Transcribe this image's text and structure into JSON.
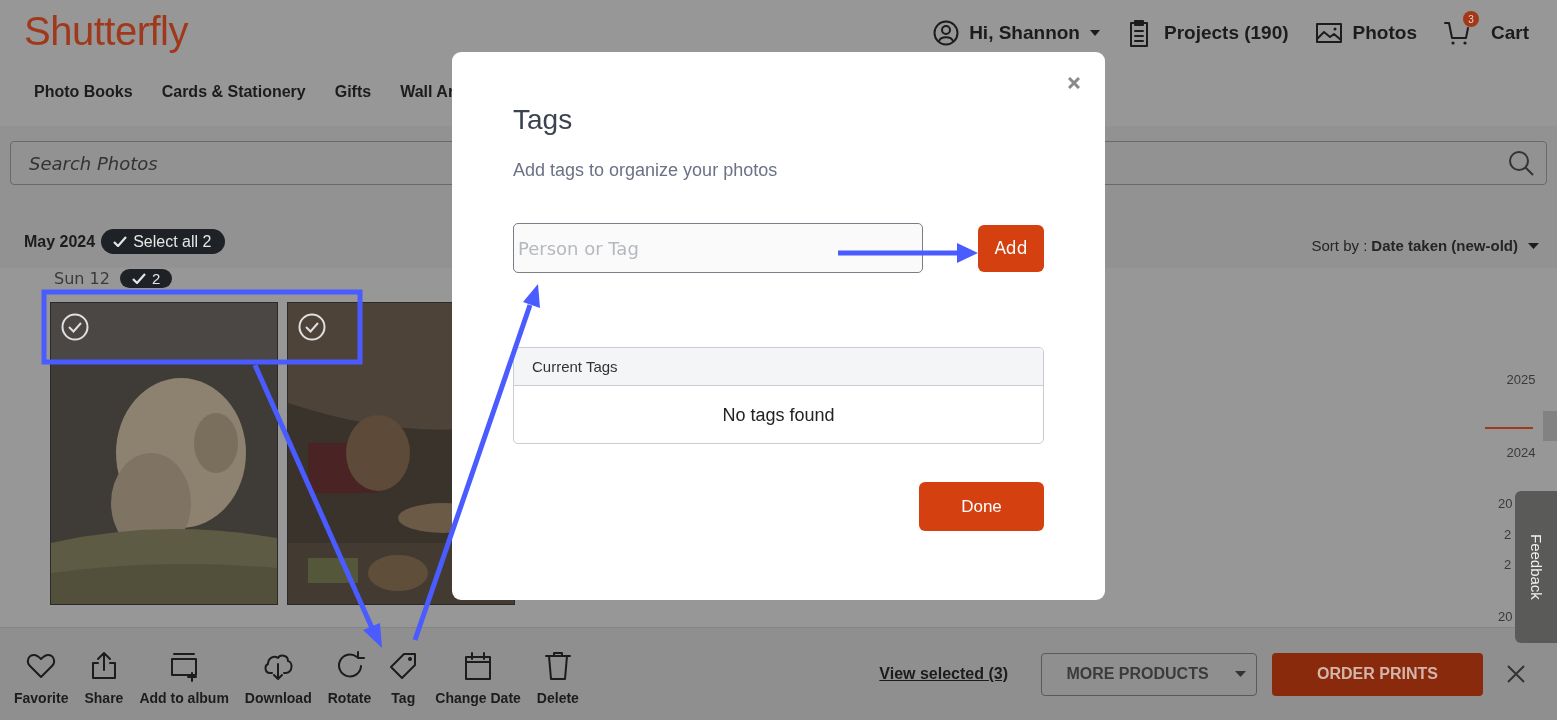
{
  "header": {
    "logo": "Shutterfly",
    "user": "Hi, Shannon",
    "links": [
      {
        "label": "Projects (190)",
        "kind": "projects"
      },
      {
        "label": "Photos",
        "kind": "photos"
      }
    ],
    "cart": {
      "label": "Cart",
      "count": "3"
    }
  },
  "categories": [
    "Photo Books",
    "Cards & Stationery",
    "Gifts",
    "Wall Ar"
  ],
  "search": {
    "placeholder": "Search Photos"
  },
  "month": {
    "label": "May 2024",
    "select_all": "Select all 2"
  },
  "sort": {
    "label": "Sort by :",
    "value": "Date taken (new-old)"
  },
  "day": {
    "label": "Sun 12",
    "count": "2"
  },
  "photos": [
    {
      "selected": true,
      "kind": "picture"
    },
    {
      "selected": true,
      "kind": "picture"
    }
  ],
  "timeline": [
    "2025",
    "2024",
    "20",
    "2",
    "2",
    "20"
  ],
  "feedback": "Feedback",
  "actions": [
    {
      "label": "Favorite",
      "kind": "heart"
    },
    {
      "label": "Share",
      "kind": "share"
    },
    {
      "label": "Add to album",
      "kind": "album"
    },
    {
      "label": "Download",
      "kind": "download"
    },
    {
      "label": "Rotate",
      "kind": "rotate"
    },
    {
      "label": "Tag",
      "kind": "tag"
    },
    {
      "label": "Change Date",
      "kind": "calendar"
    },
    {
      "label": "Delete",
      "kind": "trash"
    }
  ],
  "view_selected": "View selected (3)",
  "more_products": "MORE PRODUCTS",
  "order_prints": "ORDER PRINTS",
  "dialog": {
    "title": "Tags",
    "subtitle": "Add tags to organize your photos",
    "input_placeholder": "Person or Tag",
    "add": "Add",
    "current_tags_header": "Current Tags",
    "empty": "No tags found",
    "done": "Done"
  }
}
